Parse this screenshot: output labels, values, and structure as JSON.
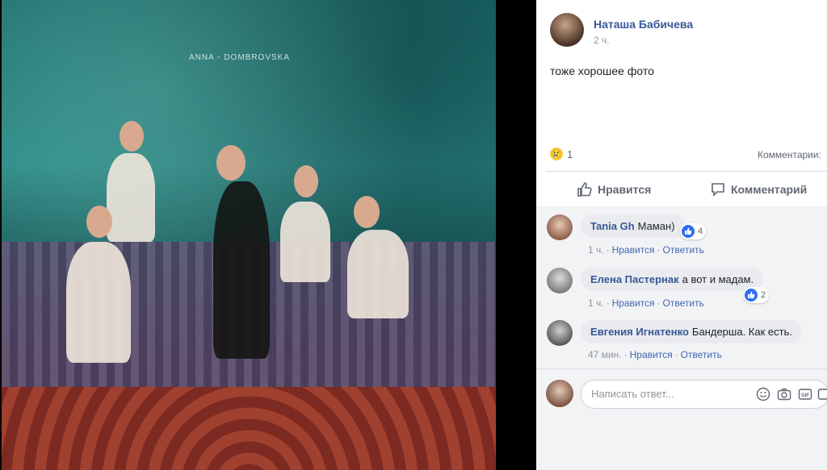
{
  "photo": {
    "watermark": "ANNA ◦ DOMBROVSKA"
  },
  "post": {
    "author": "Наташа Бабичева",
    "time": "2 ч.",
    "text": "тоже хорошее фото",
    "reaction_count": "1",
    "comments_label": "Комментарии:"
  },
  "actions": {
    "like": "Нравится",
    "comment": "Комментарий"
  },
  "comments": [
    {
      "name": "Tania Gh",
      "text": "Маман)",
      "time": "1 ч.",
      "like": "Нравится",
      "reply": "Ответить",
      "likes": "4"
    },
    {
      "name": "Елена Пастернак",
      "text": "а вот и мадам.",
      "time": "1 ч.",
      "like": "Нравится",
      "reply": "Ответить",
      "likes": "2"
    },
    {
      "name": "Евгения Игнатенко",
      "text": "Бандерша. Как есть.",
      "time": "47 мин.",
      "like": "Нравится",
      "reply": "Ответить"
    }
  ],
  "composer": {
    "placeholder": "Написать ответ..."
  },
  "colors": {
    "link": "#385898",
    "meta": "#90949c",
    "bubble": "#e9ebee",
    "like_blue": "#2e6ff2"
  }
}
